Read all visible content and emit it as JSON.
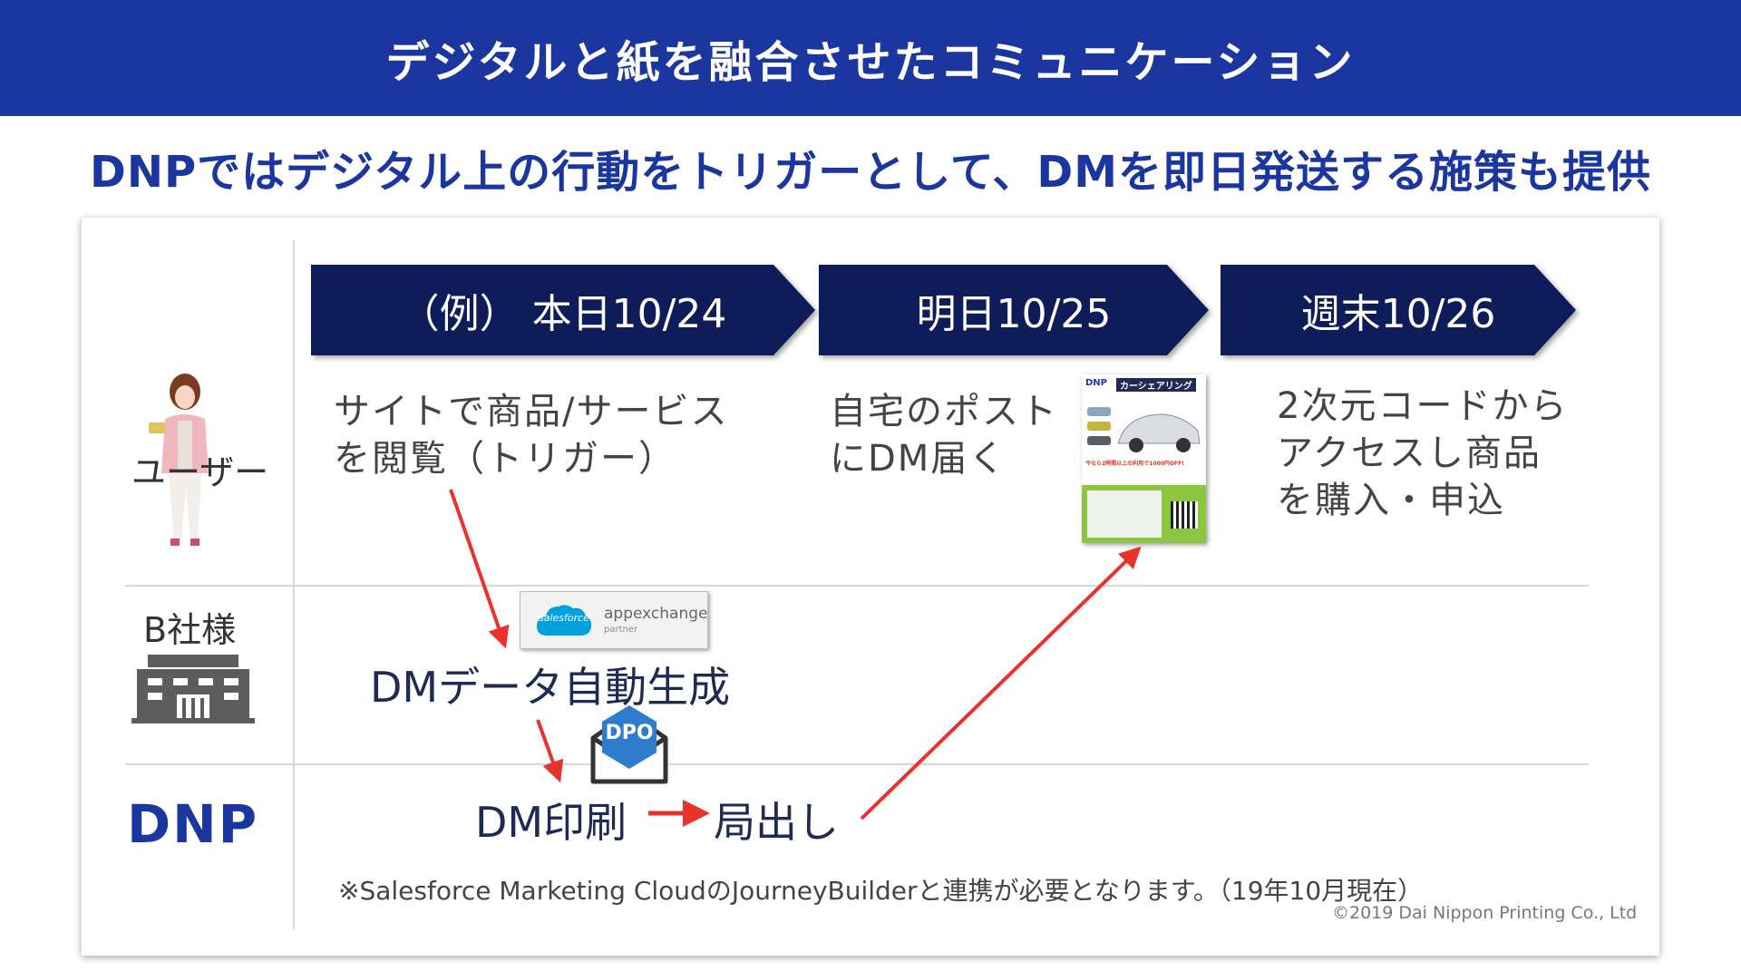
{
  "header": {
    "title": "デジタルと紙を融合させたコミュニケーション"
  },
  "subtitle": "DNPではデジタル上の行動をトリガーとして、DMを即日発送する施策も提供",
  "lanes": {
    "user": "ユーザー",
    "company_b": "B社様",
    "dnp": "DNP"
  },
  "timeline": [
    {
      "label": "（例） 本日10/24"
    },
    {
      "label": "明日10/25"
    },
    {
      "label": "週末10/26"
    }
  ],
  "user_steps": {
    "step1": [
      "サイトで商品/サービス",
      "を閲覧（トリガー）"
    ],
    "step2": [
      "自宅のポスト",
      "にDM届く"
    ],
    "step3": [
      "2次元コードから",
      "アクセスし商品",
      "を購入・申込"
    ]
  },
  "flow": {
    "dm_data": "DMデータ自動生成",
    "dm_print": "DM印刷",
    "dispatch": "局出し"
  },
  "badges": {
    "salesforce_logo": "salesforce",
    "appexchange": "appexchange",
    "partner": "partner",
    "dpo": "DPO"
  },
  "flyer": {
    "brand": "DNP",
    "title": "カーシェアリング",
    "offer": "今なら2時間以上の利用で1000円OFF!"
  },
  "note": "※Salesforce Marketing CloudのJourneyBuilderと連携が必要となります。（19年10月現在）",
  "copyright": "©2019 Dai Nippon Printing Co., Ltd",
  "colors": {
    "header_bg": "#1c36a0",
    "chevron_bg": "#0f1c5a",
    "arrow": "#e8322b",
    "dnp_logo": "#1c36a0"
  }
}
